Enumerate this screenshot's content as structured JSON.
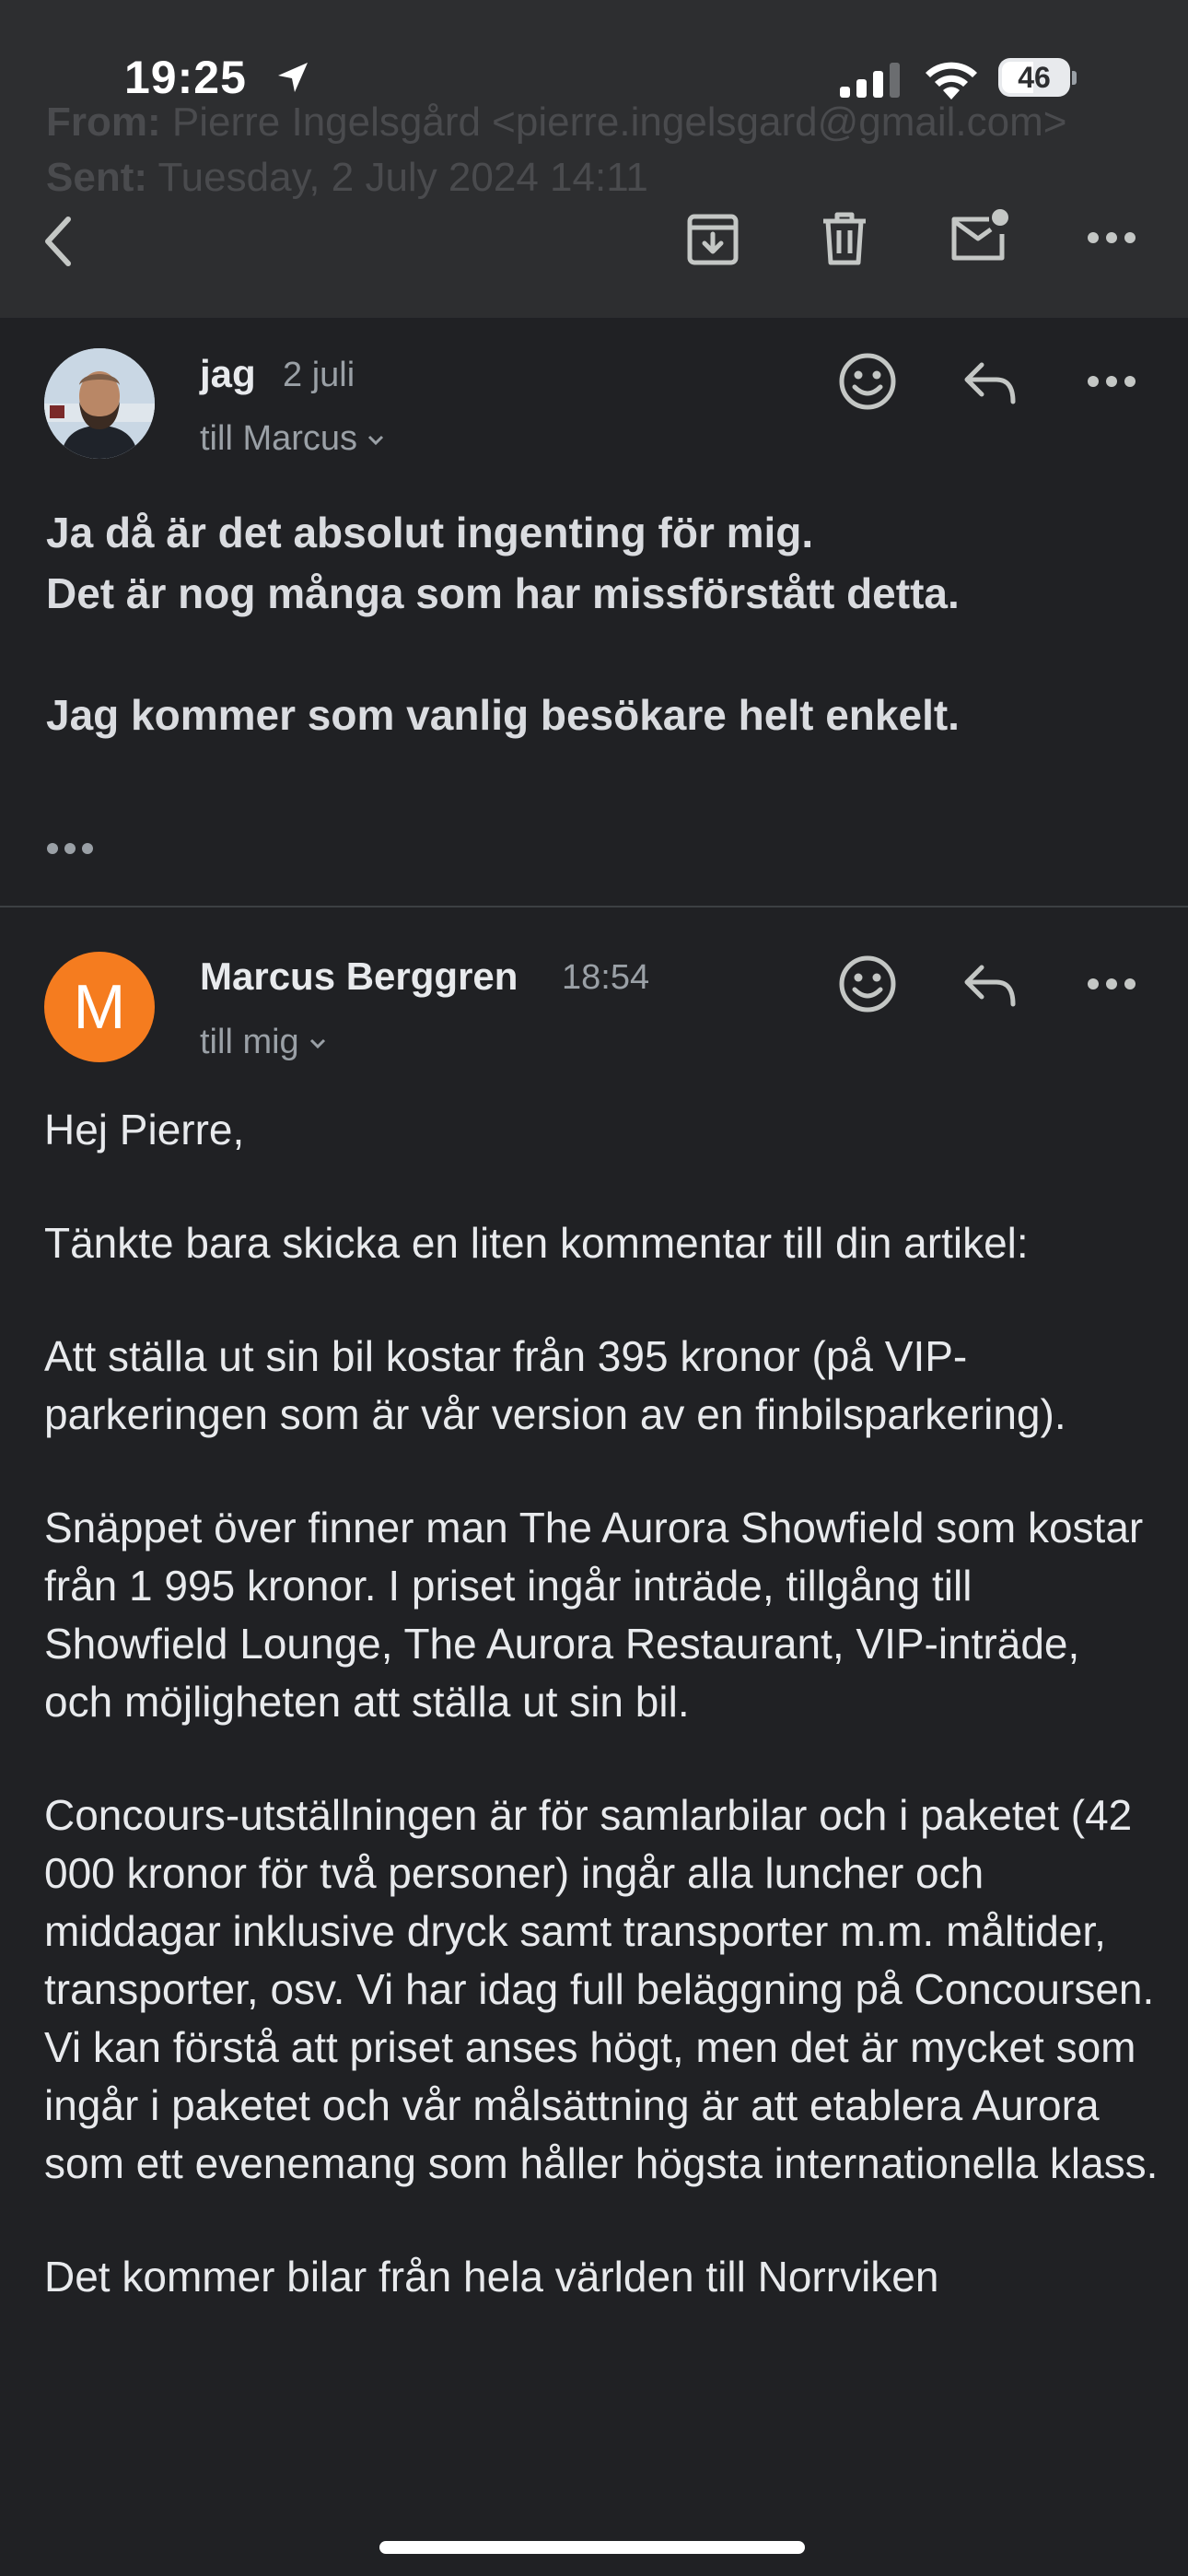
{
  "status_bar": {
    "time": "19:25",
    "battery": "46"
  },
  "background_header": {
    "from_label": "From:",
    "from_value": "Pierre Ingelsgård <pierre.ingelsgard@gmail.com>",
    "sent_label": "Sent:",
    "sent_value": "Tuesday, 2 July 2024 14:11"
  },
  "toolbar": {
    "icons": [
      "back-icon",
      "archive-icon",
      "trash-icon",
      "mark-unread-icon",
      "more-icon"
    ]
  },
  "messages": [
    {
      "sender": "jag",
      "date": "2 juli",
      "recipient": "till Marcus",
      "body": [
        "Ja då är det absolut ingenting för mig.",
        "Det är nog många som har missförstått detta.",
        "Jag kommer som vanlig besökare helt enkelt."
      ],
      "collapsed_indicator": "•••"
    },
    {
      "sender": "Marcus Berggren",
      "avatar_letter": "M",
      "date": "18:54",
      "recipient": "till mig",
      "body": [
        "Hej Pierre,",
        "Tänkte bara skicka en liten kommentar till din artikel:",
        "Att ställa ut sin bil kostar från 395 kronor (på VIP-parkeringen som är vår version av en finbilsparkering).",
        "Snäppet över finner man The Aurora Showfield som kostar från 1 995 kronor. I priset ingår inträde, tillgång till Showfield Lounge, The Aurora Restaurant, VIP-inträde, och möjligheten att ställa ut sin bil.",
        "Concours-utställningen är för samlarbilar och i paketet (42 000 kronor för två personer) ingår alla luncher och middagar inklusive dryck samt transporter m.m.  måltider, transporter, osv.  Vi har idag full beläggning på Concoursen. Vi kan förstå att priset anses högt, men det är mycket som ingår i paketet och vår målsättning är att etablera Aurora som ett evenemang som håller högsta internationella klass.",
        "Det kommer bilar från hela världen till Norrviken"
      ]
    }
  ],
  "colors": {
    "accent_avatar": "#f57c1f",
    "background": "#202124",
    "toolbar": "#2d2e30"
  }
}
